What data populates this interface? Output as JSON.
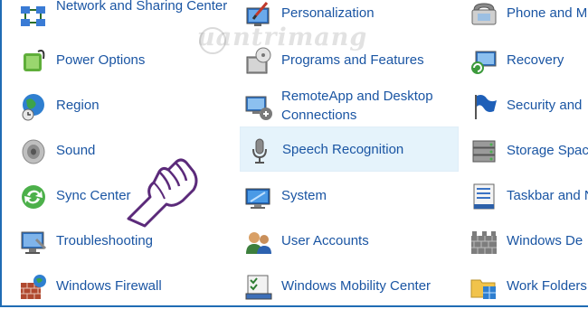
{
  "columns": [
    {
      "items": [
        {
          "label": "Network and Sharing Center",
          "icon": "network-sharing-icon"
        },
        {
          "label": "Power Options",
          "icon": "power-options-icon"
        },
        {
          "label": "Region",
          "icon": "region-globe-icon"
        },
        {
          "label": "Sound",
          "icon": "speaker-icon"
        },
        {
          "label": "Sync Center",
          "icon": "sync-icon"
        },
        {
          "label": "Troubleshooting",
          "icon": "troubleshooting-icon"
        },
        {
          "label": "Windows Firewall",
          "icon": "firewall-icon"
        }
      ]
    },
    {
      "items": [
        {
          "label": "Personalization",
          "icon": "personalization-icon"
        },
        {
          "label": "Programs and Features",
          "icon": "programs-features-icon"
        },
        {
          "label": "RemoteApp and Desktop Connections",
          "icon": "remoteapp-icon"
        },
        {
          "label": "Speech Recognition",
          "icon": "microphone-icon",
          "selected": true
        },
        {
          "label": "System",
          "icon": "system-monitor-icon"
        },
        {
          "label": "User Accounts",
          "icon": "user-accounts-icon"
        },
        {
          "label": "Windows Mobility Center",
          "icon": "mobility-center-icon"
        }
      ]
    },
    {
      "items": [
        {
          "label": "Phone and M",
          "icon": "phone-modem-icon"
        },
        {
          "label": "Recovery",
          "icon": "recovery-icon"
        },
        {
          "label": "Security and",
          "icon": "security-flag-icon"
        },
        {
          "label": "Storage Spac",
          "icon": "storage-spaces-icon"
        },
        {
          "label": "Taskbar and N",
          "icon": "taskbar-icon"
        },
        {
          "label": "Windows De",
          "icon": "windows-defender-icon"
        },
        {
          "label": "Work Folders",
          "icon": "work-folders-icon"
        }
      ]
    }
  ],
  "watermark": {
    "text": "uantrimang"
  },
  "colors": {
    "link": "#1a55a3",
    "selected_bg": "#e5f3fb",
    "frame": "#1f6cb4"
  }
}
